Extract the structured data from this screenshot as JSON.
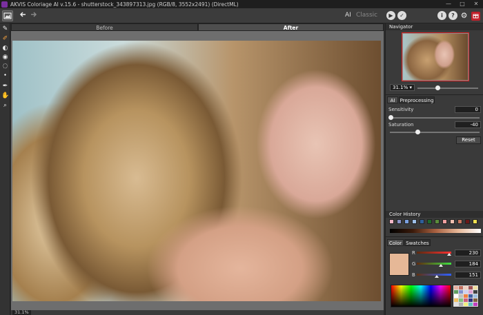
{
  "window": {
    "title": "AKVIS Coloriage AI v.15.6 - shutterstock_343897313.jpg (RGB/8, 3552x2491) (DirectML)",
    "minimize": "—",
    "maximize": "□",
    "close": "✕"
  },
  "toolbar": {
    "mode_ai": "AI",
    "mode_classic": "Classic",
    "run_label": "▶",
    "apply_label": "✓",
    "info_label": "i",
    "help_label": "?",
    "settings_label": "⚙"
  },
  "view_tabs": {
    "before": "Before",
    "after": "After"
  },
  "status": {
    "zoom": "31.1%"
  },
  "navigator": {
    "title": "Navigator",
    "zoom": "31.1% ▾"
  },
  "settings_tabs": {
    "ai": "AI",
    "preprocessing": "Preprocessing"
  },
  "params": {
    "sensitivity_label": "Sensitivity",
    "sensitivity_value": "0",
    "saturation_label": "Saturation",
    "saturation_value": "-40",
    "reset_label": "Reset"
  },
  "color_history": {
    "title": "Color History",
    "colors": [
      "#f2b6c6",
      "#8a92c8",
      "#7aa0e0",
      "#9ec0e8",
      "#2f5f9a",
      "#1e6a2a",
      "#5a8c3a",
      "#f0a0a0",
      "#f0c0b0",
      "#c87860",
      "#6a1818",
      "#f0e050"
    ]
  },
  "color_tabs": {
    "color": "Color",
    "swatches": "Swatches"
  },
  "rgb": {
    "r_label": "R",
    "r_value": "230",
    "g_label": "G",
    "g_value": "184",
    "b_label": "B",
    "b_value": "151",
    "current_color": "#e6b897"
  }
}
